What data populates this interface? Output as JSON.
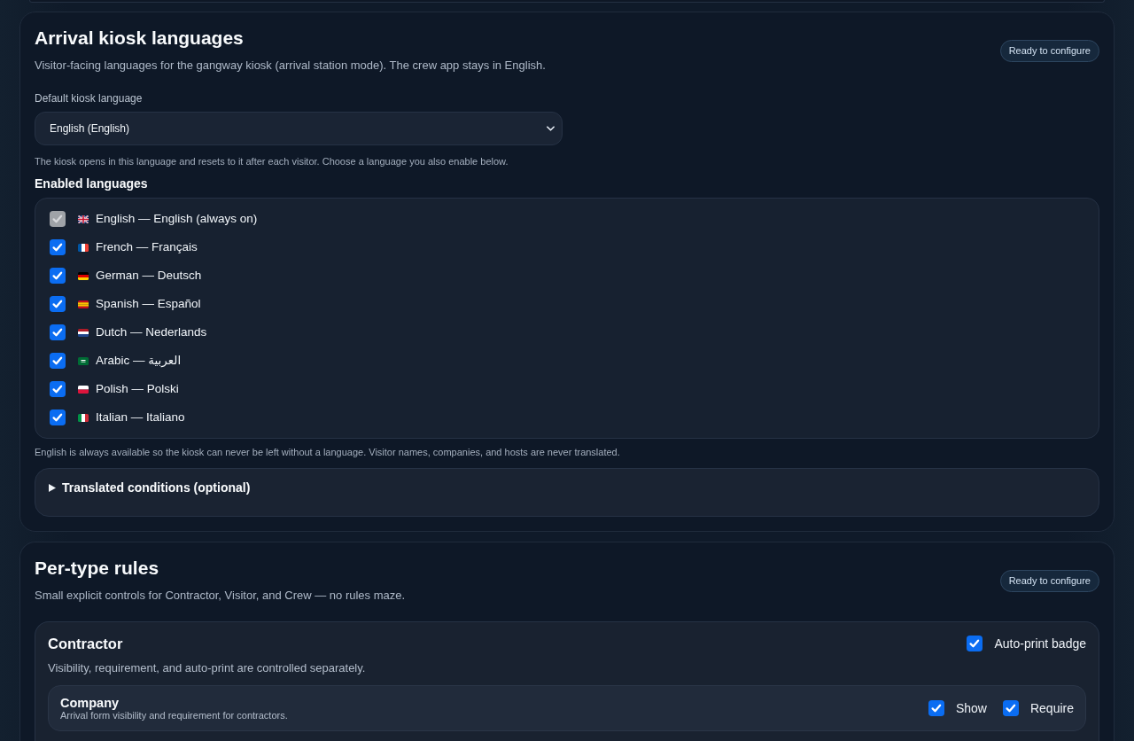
{
  "kiosk_languages": {
    "title": "Arrival kiosk languages",
    "description": "Visitor-facing languages for the gangway kiosk (arrival station mode). The crew app stays in English.",
    "status": "Ready to configure",
    "default_language": {
      "label": "Default kiosk language",
      "value": "English (English)",
      "help": "The kiosk opens in this language and resets to it after each visitor. Choose a language you also enable below."
    },
    "enabled_languages": {
      "heading": "Enabled languages",
      "items": [
        {
          "label": "English — English (always on)",
          "checked": true,
          "disabled": true
        },
        {
          "label": "French — Français",
          "checked": true,
          "disabled": false
        },
        {
          "label": "German — Deutsch",
          "checked": true,
          "disabled": false
        },
        {
          "label": "Spanish — Español",
          "checked": true,
          "disabled": false
        },
        {
          "label": "Dutch — Nederlands",
          "checked": true,
          "disabled": false
        },
        {
          "label": "Arabic — العربية",
          "checked": true,
          "disabled": false
        },
        {
          "label": "Polish — Polski",
          "checked": true,
          "disabled": false
        },
        {
          "label": "Italian — Italiano",
          "checked": true,
          "disabled": false
        }
      ],
      "note": "English is always available so the kiosk can never be left without a language. Visitor names, companies, and hosts are never translated."
    },
    "translated_conditions": {
      "label": "Translated conditions (optional)",
      "expanded": false
    }
  },
  "per_type_rules": {
    "title": "Per-type rules",
    "description": "Small explicit controls for Contractor, Visitor, and Crew — no rules maze.",
    "status": "Ready to configure",
    "types": [
      {
        "name": "Contractor",
        "description": "Visibility, requirement, and auto-print are controlled separately.",
        "auto_print": {
          "label": "Auto-print badge",
          "checked": true
        },
        "fields": [
          {
            "name": "Company",
            "description": "Arrival form visibility and requirement for contractors.",
            "show": {
              "label": "Show",
              "checked": true
            },
            "require": {
              "label": "Require",
              "checked": true
            }
          }
        ]
      }
    ]
  }
}
